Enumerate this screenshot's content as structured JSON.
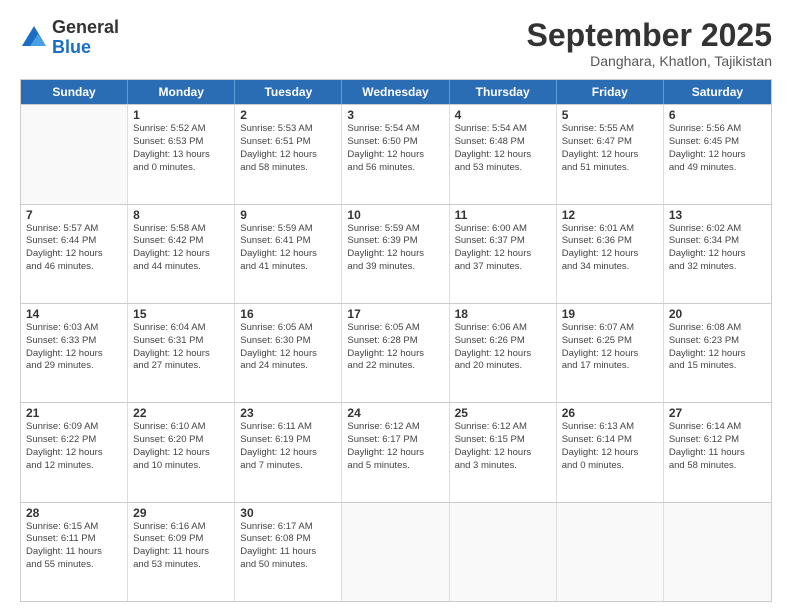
{
  "logo": {
    "general": "General",
    "blue": "Blue"
  },
  "header": {
    "month": "September 2025",
    "location": "Danghara, Khatlon, Tajikistan"
  },
  "weekdays": [
    "Sunday",
    "Monday",
    "Tuesday",
    "Wednesday",
    "Thursday",
    "Friday",
    "Saturday"
  ],
  "weeks": [
    [
      {
        "day": "",
        "info": ""
      },
      {
        "day": "1",
        "info": "Sunrise: 5:52 AM\nSunset: 6:53 PM\nDaylight: 13 hours\nand 0 minutes."
      },
      {
        "day": "2",
        "info": "Sunrise: 5:53 AM\nSunset: 6:51 PM\nDaylight: 12 hours\nand 58 minutes."
      },
      {
        "day": "3",
        "info": "Sunrise: 5:54 AM\nSunset: 6:50 PM\nDaylight: 12 hours\nand 56 minutes."
      },
      {
        "day": "4",
        "info": "Sunrise: 5:54 AM\nSunset: 6:48 PM\nDaylight: 12 hours\nand 53 minutes."
      },
      {
        "day": "5",
        "info": "Sunrise: 5:55 AM\nSunset: 6:47 PM\nDaylight: 12 hours\nand 51 minutes."
      },
      {
        "day": "6",
        "info": "Sunrise: 5:56 AM\nSunset: 6:45 PM\nDaylight: 12 hours\nand 49 minutes."
      }
    ],
    [
      {
        "day": "7",
        "info": "Sunrise: 5:57 AM\nSunset: 6:44 PM\nDaylight: 12 hours\nand 46 minutes."
      },
      {
        "day": "8",
        "info": "Sunrise: 5:58 AM\nSunset: 6:42 PM\nDaylight: 12 hours\nand 44 minutes."
      },
      {
        "day": "9",
        "info": "Sunrise: 5:59 AM\nSunset: 6:41 PM\nDaylight: 12 hours\nand 41 minutes."
      },
      {
        "day": "10",
        "info": "Sunrise: 5:59 AM\nSunset: 6:39 PM\nDaylight: 12 hours\nand 39 minutes."
      },
      {
        "day": "11",
        "info": "Sunrise: 6:00 AM\nSunset: 6:37 PM\nDaylight: 12 hours\nand 37 minutes."
      },
      {
        "day": "12",
        "info": "Sunrise: 6:01 AM\nSunset: 6:36 PM\nDaylight: 12 hours\nand 34 minutes."
      },
      {
        "day": "13",
        "info": "Sunrise: 6:02 AM\nSunset: 6:34 PM\nDaylight: 12 hours\nand 32 minutes."
      }
    ],
    [
      {
        "day": "14",
        "info": "Sunrise: 6:03 AM\nSunset: 6:33 PM\nDaylight: 12 hours\nand 29 minutes."
      },
      {
        "day": "15",
        "info": "Sunrise: 6:04 AM\nSunset: 6:31 PM\nDaylight: 12 hours\nand 27 minutes."
      },
      {
        "day": "16",
        "info": "Sunrise: 6:05 AM\nSunset: 6:30 PM\nDaylight: 12 hours\nand 24 minutes."
      },
      {
        "day": "17",
        "info": "Sunrise: 6:05 AM\nSunset: 6:28 PM\nDaylight: 12 hours\nand 22 minutes."
      },
      {
        "day": "18",
        "info": "Sunrise: 6:06 AM\nSunset: 6:26 PM\nDaylight: 12 hours\nand 20 minutes."
      },
      {
        "day": "19",
        "info": "Sunrise: 6:07 AM\nSunset: 6:25 PM\nDaylight: 12 hours\nand 17 minutes."
      },
      {
        "day": "20",
        "info": "Sunrise: 6:08 AM\nSunset: 6:23 PM\nDaylight: 12 hours\nand 15 minutes."
      }
    ],
    [
      {
        "day": "21",
        "info": "Sunrise: 6:09 AM\nSunset: 6:22 PM\nDaylight: 12 hours\nand 12 minutes."
      },
      {
        "day": "22",
        "info": "Sunrise: 6:10 AM\nSunset: 6:20 PM\nDaylight: 12 hours\nand 10 minutes."
      },
      {
        "day": "23",
        "info": "Sunrise: 6:11 AM\nSunset: 6:19 PM\nDaylight: 12 hours\nand 7 minutes."
      },
      {
        "day": "24",
        "info": "Sunrise: 6:12 AM\nSunset: 6:17 PM\nDaylight: 12 hours\nand 5 minutes."
      },
      {
        "day": "25",
        "info": "Sunrise: 6:12 AM\nSunset: 6:15 PM\nDaylight: 12 hours\nand 3 minutes."
      },
      {
        "day": "26",
        "info": "Sunrise: 6:13 AM\nSunset: 6:14 PM\nDaylight: 12 hours\nand 0 minutes."
      },
      {
        "day": "27",
        "info": "Sunrise: 6:14 AM\nSunset: 6:12 PM\nDaylight: 11 hours\nand 58 minutes."
      }
    ],
    [
      {
        "day": "28",
        "info": "Sunrise: 6:15 AM\nSunset: 6:11 PM\nDaylight: 11 hours\nand 55 minutes."
      },
      {
        "day": "29",
        "info": "Sunrise: 6:16 AM\nSunset: 6:09 PM\nDaylight: 11 hours\nand 53 minutes."
      },
      {
        "day": "30",
        "info": "Sunrise: 6:17 AM\nSunset: 6:08 PM\nDaylight: 11 hours\nand 50 minutes."
      },
      {
        "day": "",
        "info": ""
      },
      {
        "day": "",
        "info": ""
      },
      {
        "day": "",
        "info": ""
      },
      {
        "day": "",
        "info": ""
      }
    ]
  ]
}
